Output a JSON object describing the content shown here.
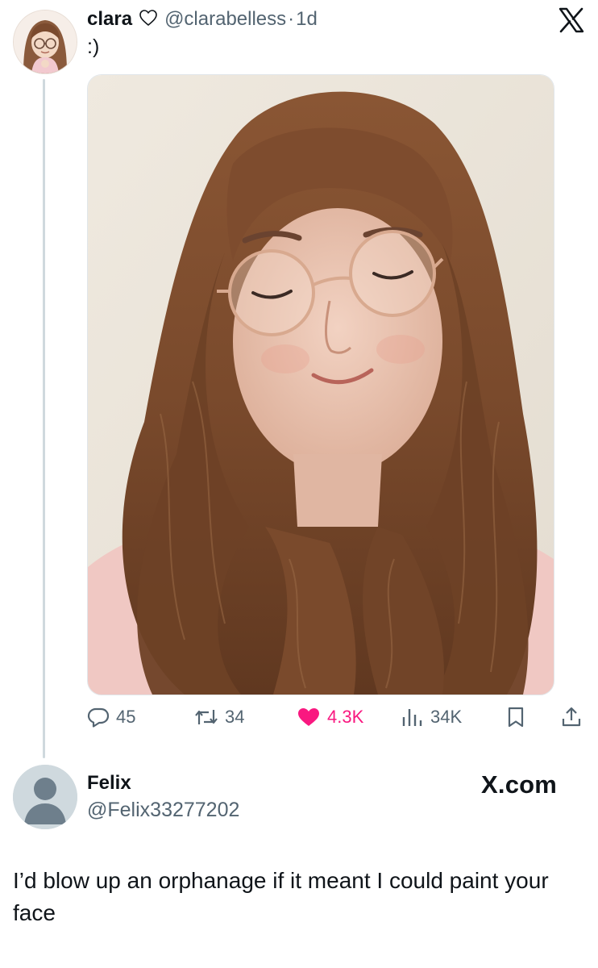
{
  "tweet": {
    "author": {
      "display_name": "clara",
      "handle": "@clarabelless",
      "time_sep": "·",
      "time": "1d",
      "name_icon": "heart-outline-icon"
    },
    "text": ":)",
    "platform_logo": "x-logo-icon",
    "media": {
      "kind": "photo"
    },
    "actions": {
      "replies": "45",
      "reposts": "34",
      "likes": "4.3K",
      "views": "34K",
      "bookmark_icon": "bookmark-icon",
      "share_icon": "share-icon"
    },
    "colors": {
      "like_active": "#f91880",
      "meta_gray": "#536471",
      "text": "#0f1419"
    }
  },
  "reply": {
    "author": {
      "display_name": "Felix",
      "handle": "@Felix33277202"
    },
    "watermark": "X.com",
    "text": "I’d blow up an orphanage if it meant I could paint your face"
  }
}
